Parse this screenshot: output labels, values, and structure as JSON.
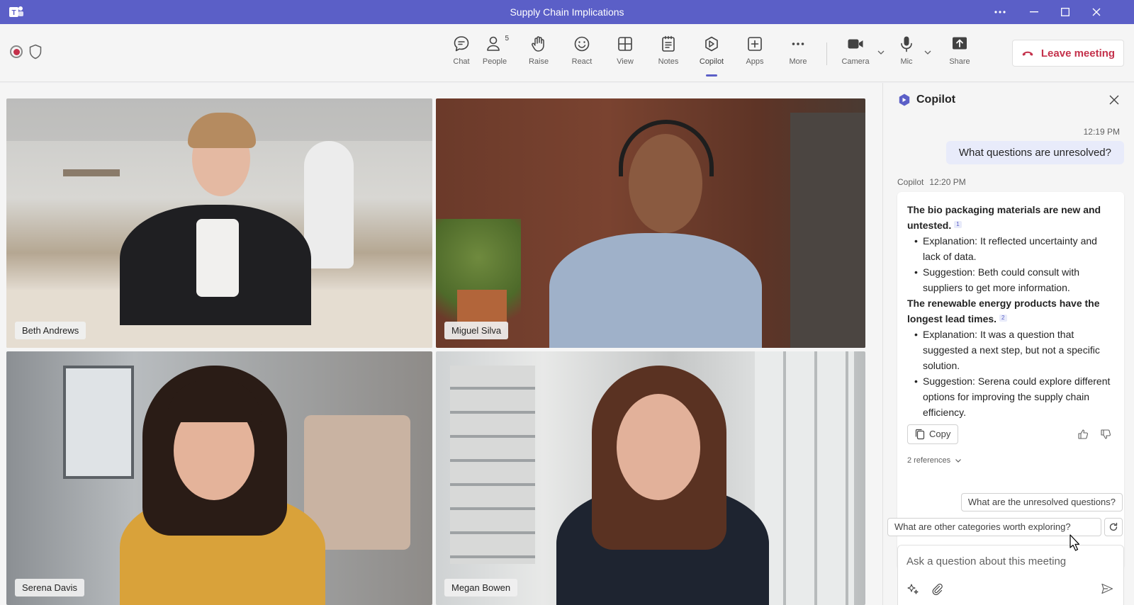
{
  "window": {
    "title": "Supply Chain Implications",
    "app_icon": "teams-icon",
    "controls": [
      "more-icon",
      "minimize-icon",
      "maximize-icon",
      "close-icon"
    ]
  },
  "toolbar": {
    "items": [
      {
        "label": "Chat",
        "icon": "chat-icon"
      },
      {
        "label": "People",
        "icon": "people-icon",
        "count": "5"
      },
      {
        "label": "Raise",
        "icon": "hand-icon"
      },
      {
        "label": "React",
        "icon": "smile-icon"
      },
      {
        "label": "View",
        "icon": "grid-icon"
      },
      {
        "label": "Notes",
        "icon": "notes-icon"
      },
      {
        "label": "Copilot",
        "icon": "copilot-icon",
        "active": true
      },
      {
        "label": "Apps",
        "icon": "plus-icon"
      },
      {
        "label": "More",
        "icon": "more-icon"
      },
      {
        "label": "Camera",
        "icon": "camera-icon"
      },
      {
        "label": "Mic",
        "icon": "mic-icon"
      },
      {
        "label": "Share",
        "icon": "share-icon"
      }
    ],
    "leave_label": "Leave meeting",
    "leave_color": "#c4314b",
    "accent": "#5b5fc7"
  },
  "participants": [
    {
      "name": "Beth Andrews"
    },
    {
      "name": "Miguel Silva"
    },
    {
      "name": "Serena Davis"
    },
    {
      "name": "Megan Bowen"
    }
  ],
  "copilot": {
    "title": "Copilot",
    "user_time": "12:19 PM",
    "user_message": "What questions are unresolved?",
    "reply_author": "Copilot",
    "reply_time": "12:20 PM",
    "sections": [
      {
        "heading": "The bio packaging materials are new and untested.",
        "ref": "1",
        "bullets": [
          "Explanation: It reflected uncertainty and lack of data.",
          "Suggestion: Beth could consult with suppliers to get more information."
        ]
      },
      {
        "heading": "The renewable energy products have the longest lead times.",
        "ref": "2",
        "bullets": [
          "Explanation: It was a question that suggested a next step, but not a specific solution.",
          "Suggestion: Serena could explore different options for improving the supply chain efficiency."
        ]
      }
    ],
    "copy_label": "Copy",
    "references_label": "2 references",
    "suggestions": [
      "What are the unresolved questions?",
      "What are other categories worth exploring?"
    ],
    "input_placeholder": "Ask a question about this meeting"
  }
}
